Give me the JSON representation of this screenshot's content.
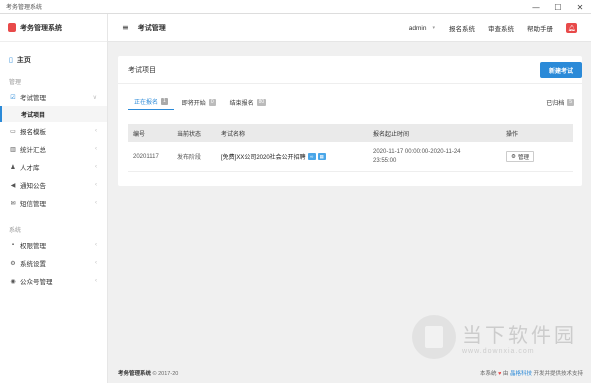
{
  "window": {
    "title": "考务管理系统"
  },
  "sidebar": {
    "brand": "考务管理系统",
    "home": "主页",
    "section_manage": "管理",
    "items": [
      {
        "label": "考试管理",
        "icon": "checkbox-icon",
        "expanded": true
      },
      {
        "label": "报名模板",
        "icon": "template-icon"
      },
      {
        "label": "统计汇总",
        "icon": "bar-chart-icon"
      },
      {
        "label": "人才库",
        "icon": "person-icon"
      },
      {
        "label": "通知公告",
        "icon": "megaphone-icon"
      },
      {
        "label": "短信管理",
        "icon": "envelope-icon"
      }
    ],
    "sub_active": "考试项目",
    "section_system": "系统",
    "system_items": [
      {
        "label": "权限管理",
        "icon": "lock-icon"
      },
      {
        "label": "系统设置",
        "icon": "gear-icon"
      },
      {
        "label": "公众号管理",
        "icon": "globe-icon"
      }
    ]
  },
  "topbar": {
    "title": "考试管理",
    "user": "admin",
    "links": [
      "报名系统",
      "审查系统",
      "帮助手册"
    ]
  },
  "card": {
    "title": "考试项目",
    "new_button": "新建考试",
    "tabs": [
      {
        "label": "正在报名",
        "count": "1"
      },
      {
        "label": "即将开始",
        "count": "0"
      },
      {
        "label": "结束报名",
        "count": "80"
      }
    ],
    "archived": {
      "label": "已归档",
      "count": "5"
    }
  },
  "table": {
    "headers": [
      "编号",
      "当前状态",
      "考试名称",
      "报名起止时间",
      "操作"
    ],
    "rows": [
      {
        "id": "20201117",
        "status": "发布阶段",
        "name": "[免费]XX公司2020社会公开招聘",
        "time_start": "2020-11-17 00:00:00-2020-11-24",
        "time_end": "23:55:00",
        "action": "管理"
      }
    ]
  },
  "footer": {
    "brand": "考务管理系统",
    "copyright": "© 2017-20",
    "right_prefix": "本系统",
    "right_mid": "由",
    "right_company": "晶格科技",
    "right_suffix": "开发并提供技术支持"
  },
  "watermark": {
    "name": "当下软件园",
    "url": "www.downxia.com"
  },
  "colors": {
    "accent": "#2b8ad8",
    "danger": "#e84a4a"
  }
}
